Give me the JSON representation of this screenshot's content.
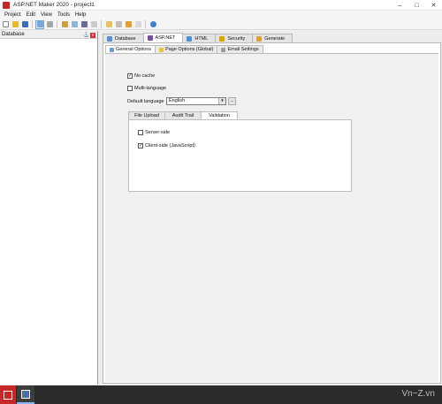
{
  "window": {
    "title": "ASP.NET Maker 2020 - project1",
    "controls": [
      "minimize-icon",
      "maximize-icon",
      "close-icon"
    ]
  },
  "menubar": {
    "items": [
      "Project",
      "Edit",
      "View",
      "Tools",
      "Help"
    ]
  },
  "toolbar": {
    "buttons": [
      "new-icon",
      "open-icon",
      "save-icon",
      "layout-icon",
      "copy-icon",
      "paste-icon",
      "find-icon",
      "generate-icon",
      "delete-icon",
      "edit-icon",
      "refresh-icon",
      "help-icon"
    ]
  },
  "left_panel": {
    "title": "Database",
    "pin": "⚓",
    "close": "x"
  },
  "main_tabs": {
    "items": [
      {
        "label": "Database",
        "icon": "database-icon",
        "color": "#5b8fd6"
      },
      {
        "label": "ASP.NET",
        "icon": "aspnet-icon",
        "color": "#7a4fa1"
      },
      {
        "label": "HTML",
        "icon": "html-icon",
        "color": "#4a90d9"
      },
      {
        "label": "Security",
        "icon": "lock-icon",
        "color": "#d9a800"
      },
      {
        "label": "Generate",
        "icon": "pencil-icon",
        "color": "#e0a030"
      }
    ],
    "active": "ASP.NET"
  },
  "sub_tabs": {
    "items": [
      {
        "label": "General Options",
        "icon": "options-icon"
      },
      {
        "label": "Page Options (Global)",
        "icon": "page-icon"
      },
      {
        "label": "Email Settings",
        "icon": "email-icon"
      }
    ],
    "active": "General Options"
  },
  "options": {
    "no_cache": {
      "label": "No cache",
      "checked": true,
      "mark": "✓"
    },
    "multi_language": {
      "label": "Multi-language",
      "checked": false,
      "mark": ""
    }
  },
  "default_language": {
    "label": "Default language",
    "value": "English",
    "arrow": "▾",
    "more": "..."
  },
  "inner_tabs": {
    "items": [
      "File Upload",
      "Audit Trail",
      "Validation"
    ],
    "active": "Validation"
  },
  "validation": {
    "server_side": {
      "label": "Server-side",
      "checked": false,
      "mark": ""
    },
    "client_side": {
      "label": "Client-side (JavaScript)",
      "checked": true,
      "mark": "✓"
    }
  },
  "taskbar": {
    "watermark": "Vn−Z.vn"
  }
}
